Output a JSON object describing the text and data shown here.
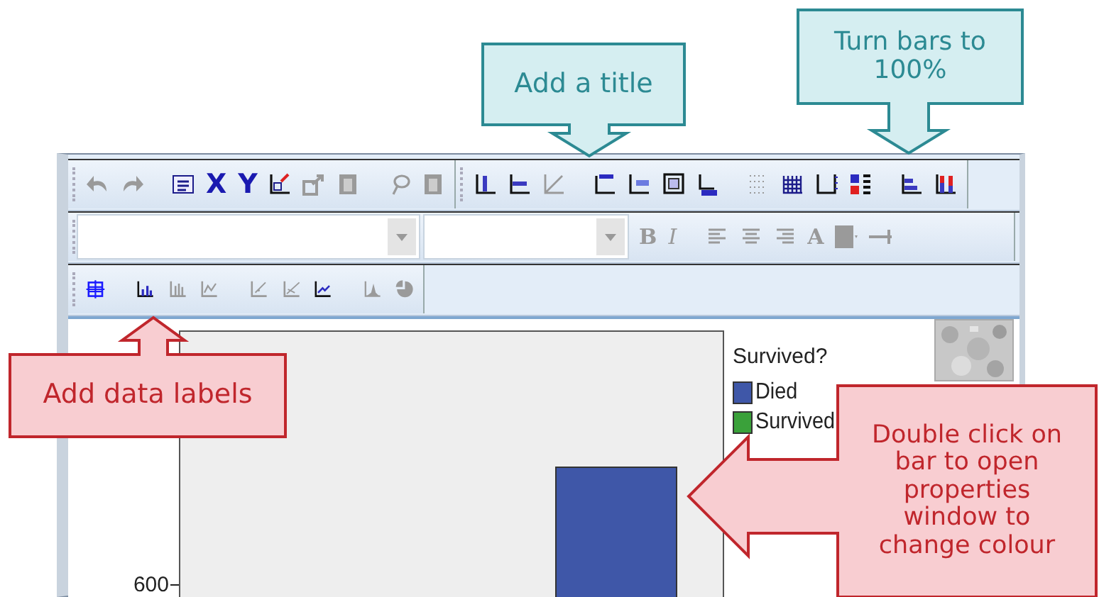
{
  "toolbars": [
    {
      "groups": [
        {
          "items": [
            {
              "kind": "undo",
              "disabled": true
            },
            {
              "kind": "redo",
              "disabled": true
            },
            {
              "kind": "properties",
              "disabled": false
            },
            {
              "kind": "text",
              "label": "X",
              "disabled": false
            },
            {
              "kind": "text",
              "label": "Y",
              "disabled": false
            },
            {
              "kind": "scale",
              "disabled": false
            },
            {
              "kind": "export",
              "disabled": true
            },
            {
              "kind": "block",
              "disabled": true
            },
            {
              "kind": "lasso",
              "disabled": true
            },
            {
              "kind": "block",
              "disabled": true
            }
          ]
        },
        {
          "items": [
            {
              "kind": "axis-v",
              "disabled": false
            },
            {
              "kind": "axis-h",
              "disabled": false
            },
            {
              "kind": "diagonal",
              "disabled": true
            },
            {
              "kind": "title",
              "disabled": false
            },
            {
              "kind": "legend",
              "disabled": false
            },
            {
              "kind": "textbox",
              "disabled": false
            },
            {
              "kind": "footnote",
              "disabled": false
            },
            {
              "kind": "grid-dots",
              "disabled": true
            },
            {
              "kind": "grid",
              "disabled": false
            },
            {
              "kind": "axis-ticks",
              "disabled": false
            },
            {
              "kind": "legend-ab",
              "disabled": false
            },
            {
              "kind": "bars-h",
              "disabled": false
            },
            {
              "kind": "bars-100",
              "disabled": false
            }
          ]
        }
      ]
    },
    {
      "groups": [
        {
          "items": [
            {
              "kind": "dropdown",
              "disabled": true
            },
            {
              "kind": "dropdown-small",
              "disabled": true
            },
            {
              "kind": "text",
              "label": "B",
              "disabled": true
            },
            {
              "kind": "text",
              "label": "I",
              "disabled": true
            },
            {
              "kind": "align-left",
              "disabled": true
            },
            {
              "kind": "align-center",
              "disabled": true
            },
            {
              "kind": "align-right",
              "disabled": true
            },
            {
              "kind": "text",
              "label": "A",
              "disabled": true
            },
            {
              "kind": "fill",
              "disabled": true
            },
            {
              "kind": "line-style",
              "disabled": true
            }
          ]
        }
      ]
    },
    {
      "groups": [
        {
          "items": [
            {
              "kind": "crosshair",
              "disabled": false
            },
            {
              "kind": "bar-labels",
              "disabled": false
            },
            {
              "kind": "bars",
              "disabled": true
            },
            {
              "kind": "line",
              "disabled": true
            },
            {
              "kind": "scatter",
              "disabled": true
            },
            {
              "kind": "scatter-fit",
              "disabled": true
            },
            {
              "kind": "line-fit",
              "disabled": false
            },
            {
              "kind": "peak",
              "disabled": true
            },
            {
              "kind": "pie",
              "disabled": true
            }
          ]
        }
      ]
    }
  ],
  "chart": {
    "y_tick": "600",
    "legend": {
      "title": "Survived?",
      "items": [
        {
          "label": "Died",
          "color": "#3f57a8"
        },
        {
          "label": "Survived",
          "color": "#3aa13a"
        }
      ]
    }
  },
  "callouts": [
    {
      "text": "Add a title",
      "kind": "down",
      "color": "#2c8a93"
    },
    {
      "text": "Turn bars to\n100%",
      "kind": "down",
      "color": "#2c8a93"
    },
    {
      "text": "Add data labels",
      "kind": "up",
      "color": "#c0262c"
    },
    {
      "text": "Double click on\nbar to open\nproperties\nwindow to\nchange colour",
      "kind": "left",
      "color": "#c0262c"
    }
  ]
}
